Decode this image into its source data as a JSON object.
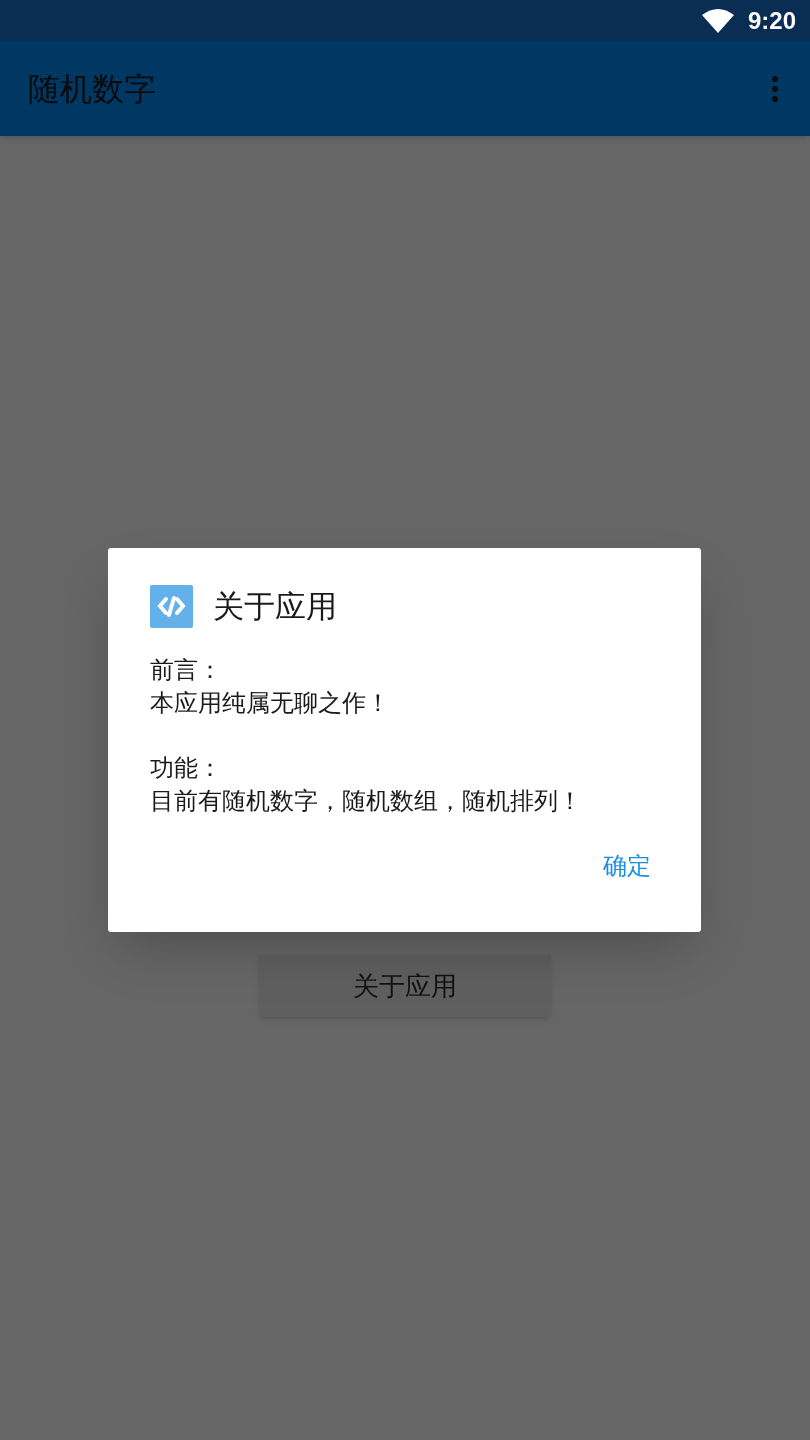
{
  "status_bar": {
    "time": "9:20"
  },
  "app_bar": {
    "title": "随机数字"
  },
  "main": {
    "button": "关于应用"
  },
  "dialog": {
    "title": "关于应用",
    "sections": [
      {
        "heading": "前言：",
        "text": "本应用纯属无聊之作！"
      },
      {
        "heading": "功能：",
        "text": "目前有随机数字，随机数组，随机排列！"
      }
    ],
    "buttons": [
      "确定"
    ]
  }
}
